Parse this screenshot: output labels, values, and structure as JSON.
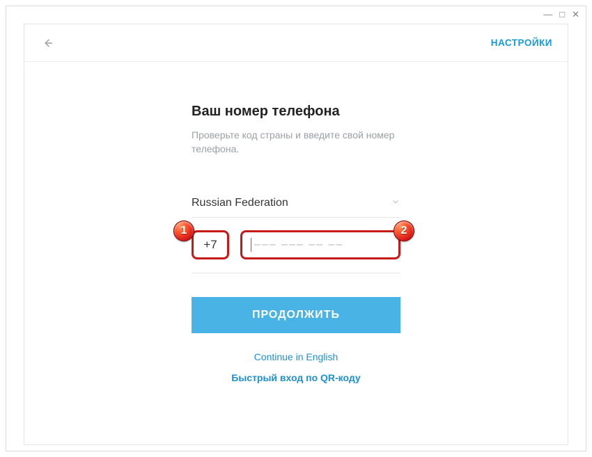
{
  "window": {
    "minimize": "—",
    "maximize": "□",
    "close": "✕"
  },
  "header": {
    "settings": "НАСТРОЙКИ"
  },
  "main": {
    "title": "Ваш номер телефона",
    "subtitle": "Проверьте код страны и введите свой номер телефона.",
    "country": "Russian Federation",
    "dial_code": "+7",
    "phone_placeholder": "––– ––– –– ––",
    "continue": "ПРОДОЛЖИТЬ",
    "english_link": "Continue in English",
    "qr_link": "Быстрый вход по QR-коду"
  },
  "annotations": {
    "badge1": "1",
    "badge2": "2"
  }
}
